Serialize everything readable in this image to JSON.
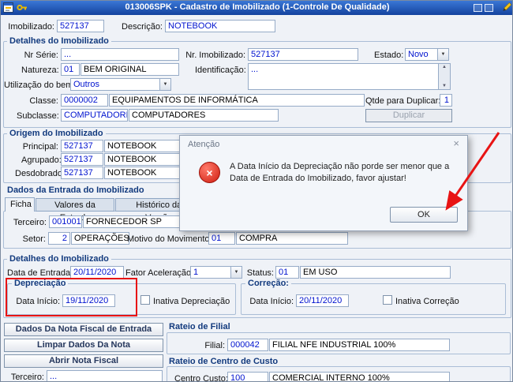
{
  "titlebar": {
    "title": "013006SPK - Cadastro de Imobilizado (1-Controle De Qualidade)"
  },
  "icons": {
    "combo_arrow": "▼",
    "scroll_up": "▲",
    "scroll_down": "▼",
    "close": "×",
    "error_cross": "×"
  },
  "colors": {
    "titlebar_blue": "#14439e",
    "field_text_blue": "#0013cf",
    "section_title_navy": "#123a7e",
    "error_red": "#cf1d10",
    "annotation_red": "#e81414"
  },
  "header": {
    "imobilizado": {
      "label": "Imobilizado:",
      "value": "527137"
    },
    "descricao": {
      "label": "Descrição:",
      "value": "NOTEBOOK"
    }
  },
  "detalhes": {
    "title": "Detalhes do Imobilizado",
    "nr_serie": {
      "label": "Nr Série:",
      "value": "..."
    },
    "nr_imobilizado": {
      "label": "Nr. Imobilizado:",
      "value": "527137"
    },
    "estado": {
      "label": "Estado:",
      "value": "Novo"
    },
    "natureza": {
      "label": "Natureza:",
      "code": "01",
      "desc": "BEM ORIGINAL"
    },
    "identificacao": {
      "label": "Identificação:",
      "value": "..."
    },
    "utilizacao": {
      "label": "Utilização do bem:",
      "value": "Outros"
    },
    "classe": {
      "label": "Classe:",
      "code": "0000002",
      "desc": "EQUIPAMENTOS DE INFORMÁTICA"
    },
    "qtde": {
      "label": "Qtde para Duplicar:",
      "value": "1"
    },
    "subclasse": {
      "label": "Subclasse:",
      "code": "COMPUTADORES",
      "desc": "COMPUTADORES"
    },
    "duplicar_button": "Duplicar"
  },
  "origem": {
    "title": "Origem do Imobilizado",
    "principal": {
      "label": "Principal:",
      "code": "527137",
      "desc": "NOTEBOOK"
    },
    "agrupado": {
      "label": "Agrupado:",
      "code": "527137",
      "desc": "NOTEBOOK"
    },
    "desdobrado": {
      "label": "Desdobrado:",
      "code": "527137",
      "desc": "NOTEBOOK"
    }
  },
  "entrada": {
    "title": "Dados da Entrada do Imobilizado",
    "tabs": [
      {
        "label": "Ficha"
      },
      {
        "label": "Valores da Entrada"
      },
      {
        "label": "Histórico das Versões"
      }
    ],
    "terceiro": {
      "label": "Terceiro:",
      "code": "001001",
      "desc": "FORNECEDOR SP"
    },
    "setor": {
      "label": "Setor:",
      "code": "2",
      "desc": "OPERAÇÕES"
    },
    "motivo": {
      "label": "Motivo do Movimento:",
      "code": "01",
      "desc": "COMPRA"
    }
  },
  "detalhes2": {
    "title": "Detalhes do Imobilizado",
    "data_entrada": {
      "label": "Data de Entrada:",
      "value": "20/11/2020"
    },
    "fator_aceleracao": {
      "label": "Fator Aceleração:",
      "value": "1"
    },
    "status": {
      "label": "Status:",
      "code": "01",
      "desc": "EM USO"
    },
    "depreciacao": {
      "title": "Depreciação",
      "data_inicio": {
        "label": "Data Início:",
        "value": "19/11/2020"
      },
      "inativa_label": "Inativa Depreciação"
    },
    "correcao": {
      "title": "Correção:",
      "data_inicio": {
        "label": "Data Início:",
        "value": "20/11/2020"
      },
      "inativa_label": "Inativa Correção"
    }
  },
  "nota_fiscal": {
    "dados_button": "Dados Da Nota Fiscal de Entrada",
    "limpar_button": "Limpar Dados Da Nota",
    "abrir_button": "Abrir Nota Fiscal",
    "terceiro": {
      "label": "Terceiro:",
      "value": "..."
    }
  },
  "rateio_filial": {
    "title": "Rateio de Filial",
    "filial": {
      "label": "Filial:",
      "code": "000042",
      "desc": "FILIAL NFE INDUSTRIAL 100%"
    }
  },
  "rateio_centro_custo": {
    "title": "Rateio de Centro de Custo",
    "centro_custo": {
      "label": "Centro Custo:",
      "code": "100",
      "desc": "COMERCIAL INTERNO 100%"
    }
  },
  "dialog": {
    "title": "Atenção",
    "message": "A Data Início da Depreciação não porde ser menor que a Data de Entrada do Imobilizado, favor ajustar!",
    "ok_button": "OK"
  }
}
